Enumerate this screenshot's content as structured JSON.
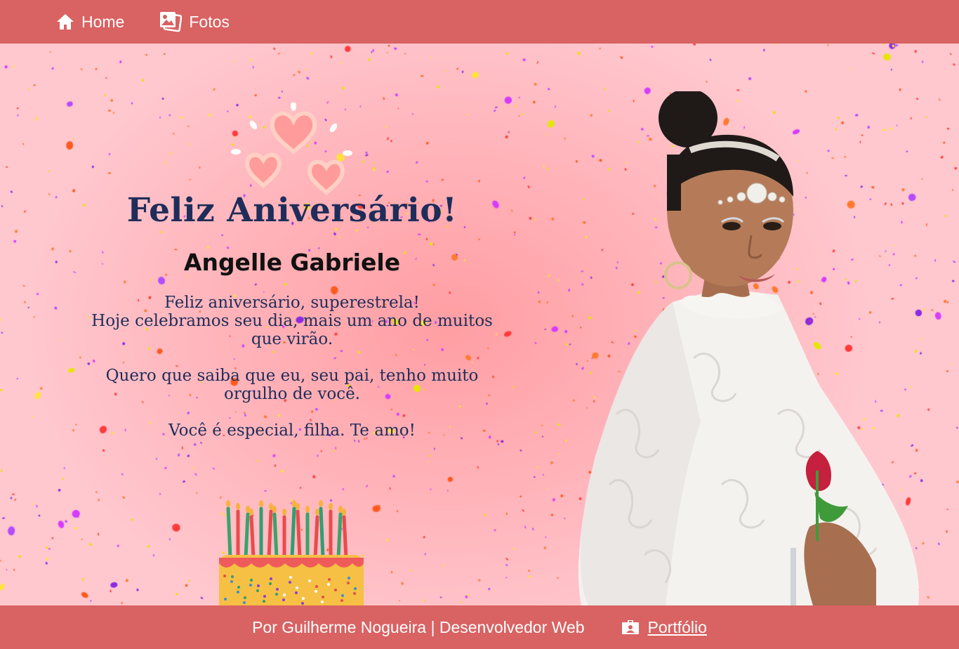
{
  "nav": {
    "items": [
      {
        "label": "Home",
        "icon": "home-icon"
      },
      {
        "label": "Fotos",
        "icon": "photos-icon"
      }
    ]
  },
  "card": {
    "title": "Feliz Aniversário!",
    "name": "Angelle Gabriele",
    "paragraphs": [
      {
        "lines": [
          "Feliz aniversário, superestrela!",
          "Hoje celebramos seu dia, mais um ano de muitos",
          "que virão."
        ]
      },
      {
        "lines": [
          "Quero que saiba que eu, seu pai, tenho muito",
          "orgulho de você."
        ]
      },
      {
        "lines": [
          "Você é especial, filha. Te amo!"
        ]
      }
    ]
  },
  "footer": {
    "credit": "Por Guilherme Nogueira | Desenvolvedor Web",
    "portfolio_label": "Portfólio",
    "portfolio_icon": "portfolio-icon"
  },
  "colors": {
    "bar": "#d96262",
    "title": "#1f2d5a",
    "background": "#ffb0b6"
  }
}
